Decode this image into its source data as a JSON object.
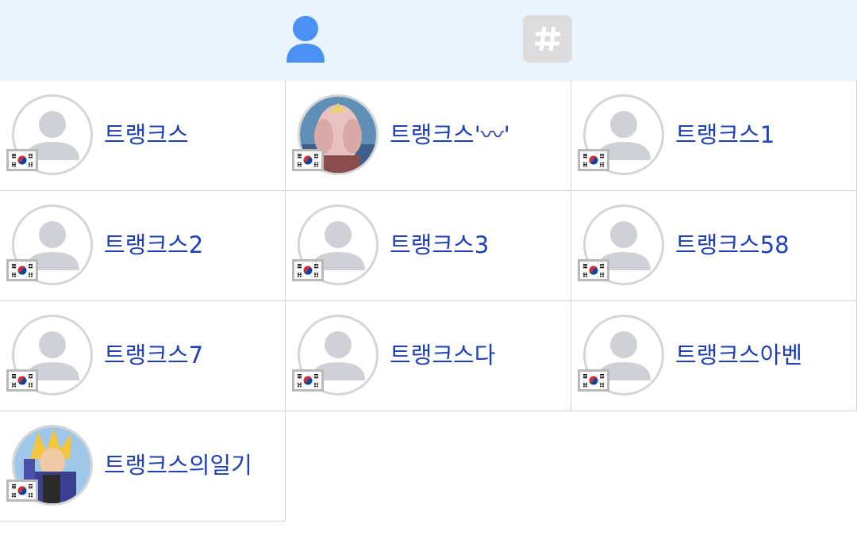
{
  "tabs": [
    {
      "icon": "person-icon",
      "active": true
    },
    {
      "icon": "hashtag-icon",
      "active": false
    }
  ],
  "accounts": [
    {
      "name": "트랭크스",
      "flag": "south-korea-flag-icon",
      "avatar": "default"
    },
    {
      "name": "트랭크스'〰'",
      "flag": "south-korea-flag-icon",
      "avatar": "photo"
    },
    {
      "name": "트랭크스1",
      "flag": "south-korea-flag-icon",
      "avatar": "default"
    },
    {
      "name": "트랭크스2",
      "flag": "south-korea-flag-icon",
      "avatar": "default"
    },
    {
      "name": "트랭크스3",
      "flag": "south-korea-flag-icon",
      "avatar": "default"
    },
    {
      "name": "트랭크스58",
      "flag": "south-korea-flag-icon",
      "avatar": "default"
    },
    {
      "name": "트랭크스7",
      "flag": "south-korea-flag-icon",
      "avatar": "default"
    },
    {
      "name": "트랭크스다",
      "flag": "south-korea-flag-icon",
      "avatar": "default"
    },
    {
      "name": "트랭크스아벤",
      "flag": "south-korea-flag-icon",
      "avatar": "default"
    },
    {
      "name": "트랭크스의일기",
      "flag": "south-korea-flag-icon",
      "avatar": "photo"
    }
  ],
  "colors": {
    "tab_bar_bg": "#eaf4fc",
    "active_tab_icon": "#4a90f5",
    "inactive_tab_bg": "#dcdcdc",
    "name_text": "#1d3fb8",
    "cell_border": "#d4d4d4",
    "default_avatar": "#cfd1d6"
  }
}
